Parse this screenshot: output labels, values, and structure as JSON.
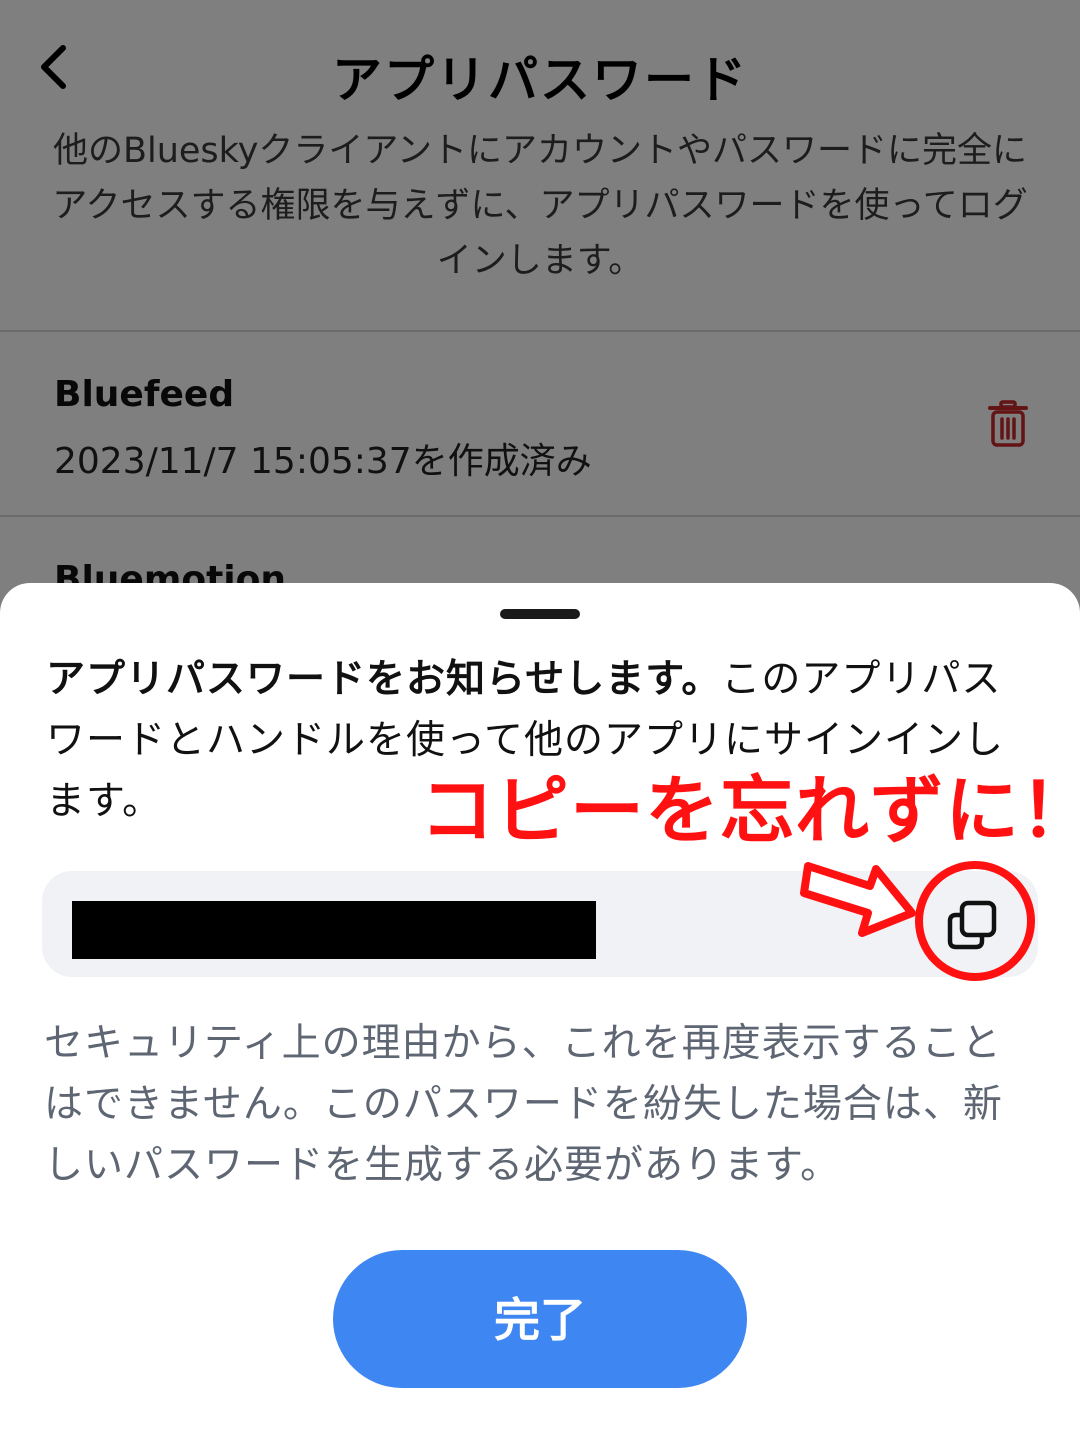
{
  "header": {
    "title": "アプリパスワード",
    "description": "他のBlueskyクライアントにアカウントやパスワードに完全にアクセスする権限を与えずに、アプリパスワードを使ってログインします。",
    "back_icon": "chevron-left-icon"
  },
  "app_passwords": [
    {
      "name": "Bluefeed",
      "created": "2023/11/7 15:05:37を作成済み",
      "delete_icon": "trash-icon"
    },
    {
      "name": "Bluemotion",
      "created": ""
    }
  ],
  "sheet": {
    "intro_bold": "アプリパスワードをお知らせします。",
    "intro_rest": "このアプリパスワードとハンドルを使って他のアプリにサインインします。",
    "password_value": "",
    "copy_icon": "copy-icon",
    "warning": "セキュリティ上の理由から、これを再度表示することはできません。このパスワードを紛失した場合は、新しいパスワードを生成する必要があります。",
    "done_label": "完了"
  },
  "annotation": {
    "text": "コピーを忘れずに！",
    "color": "#ff1111"
  },
  "colors": {
    "accent": "#3e87f2",
    "danger": "#c62828",
    "field_bg": "#f1f2f6"
  }
}
